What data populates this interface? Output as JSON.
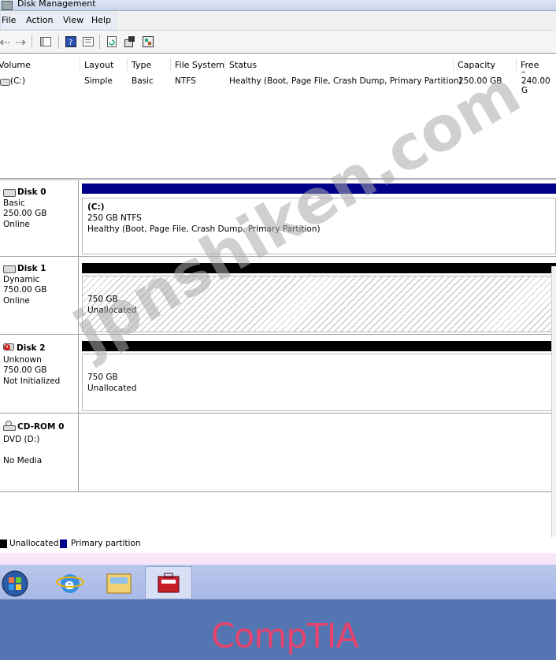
{
  "window": {
    "title": "Disk Management"
  },
  "menu": {
    "items": [
      "File",
      "Action",
      "View",
      "Help"
    ]
  },
  "toolbar": {
    "icons": [
      "back-icon",
      "forward-icon",
      "console-tree-icon",
      "help-icon",
      "properties-icon",
      "refresh-icon",
      "rescan-disks-icon",
      "settings-icon"
    ]
  },
  "volume_list": {
    "headers": [
      "Volume",
      "Layout",
      "Type",
      "File System",
      "Status",
      "Capacity",
      "Free Spac"
    ],
    "rows": [
      {
        "volume": "(C:)",
        "layout": "Simple",
        "type": "Basic",
        "fs": "NTFS",
        "status": "Healthy (Boot, Page File, Crash Dump, Primary Partition)",
        "capacity": "250.00 GB",
        "free": "240.00 G"
      }
    ]
  },
  "disks": [
    {
      "name": "Disk 0",
      "kind": "Basic",
      "size": "250.00 GB",
      "state": "Online",
      "bar_color": "#00008b",
      "volume": {
        "title": "(C:)",
        "line1": "250 GB NTFS",
        "line2": "Healthy (Boot, Page File, Crash Dump, Primary Partition)"
      }
    },
    {
      "name": "Disk 1",
      "kind": "Dynamic",
      "size": "750.00 GB",
      "state": "Online",
      "bar_color": "#000000",
      "volume": {
        "line1": "750 GB",
        "line2": "Unallocated"
      }
    },
    {
      "name": "Disk 2",
      "kind": "Unknown",
      "size": "750.00 GB",
      "state": "Not Initialized",
      "bar_color": "#000000",
      "volume": {
        "line1": "750 GB",
        "line2": "Unallocated"
      }
    },
    {
      "name": "CD-ROM 0",
      "kind": "DVD (D:)",
      "state": "No Media"
    }
  ],
  "legend": {
    "unallocated": "Unallocated",
    "primary": "Primary partition",
    "unallocated_color": "#000000",
    "primary_color": "#00008b"
  },
  "brand": "CompTIA",
  "watermark": "jpnshiken.com"
}
